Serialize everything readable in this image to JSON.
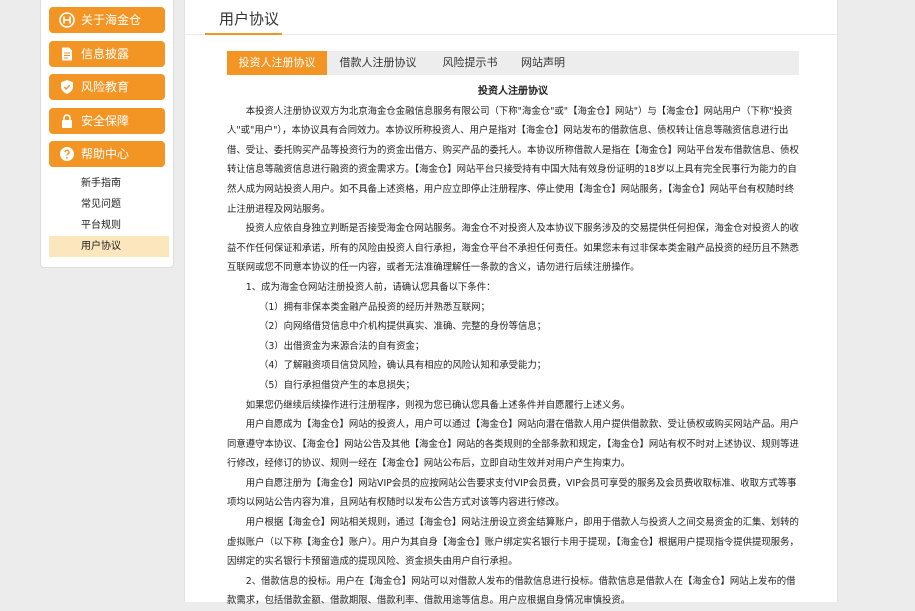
{
  "sidebar": {
    "items": [
      {
        "label": "关于海金仓",
        "icon": "logo-icon"
      },
      {
        "label": "信息披露",
        "icon": "document-icon"
      },
      {
        "label": "风险教育",
        "icon": "shield-icon"
      },
      {
        "label": "安全保障",
        "icon": "lock-icon"
      },
      {
        "label": "帮助中心",
        "icon": "question-icon"
      }
    ],
    "sub_items": [
      "新手指南",
      "常见问题",
      "平台规则",
      "用户协议"
    ]
  },
  "main": {
    "title": "用户协议",
    "tabs": [
      "投资人注册协议",
      "借款人注册协议",
      "风险提示书",
      "网站声明"
    ]
  },
  "doc": {
    "title": "投资人注册协议",
    "paragraphs": [
      "本投资人注册协议双方为北京海金仓金融信息服务有限公司（下称\"海金仓\"或\"【海金仓】网站\"）与【海金仓】网站用户（下称\"投资人\"或\"用户\"），本协议具有合同效力。本协议所称投资人、用户是指对【海金仓】网站发布的借款信息、债权转让信息等融资信息进行出借、受让、委托购买产品等投资行为的资金出借方、购买产品的委托人。本协议所称借款人是指在【海金仓】网站平台发布借款信息、债权转让信息等融资信息进行融资的资金需求方。【海金仓】网站平台只接受持有中国大陆有效身份证明的18岁以上具有完全民事行为能力的自然人成为网站投资人用户。如不具备上述资格，用户应立即停止注册程序、停止使用【海金仓】网站服务，【海金仓】网站平台有权随时终止注册进程及网站服务。",
      "投资人应依自身独立判断是否接受海金仓网站服务。海金仓不对投资人及本协议下服务涉及的交易提供任何担保，海金仓对投资人的收益不作任何保证和承诺，所有的风险由投资人自行承担，海金仓平台不承担任何责任。如果您未有过非保本类金融产品投资的经历且不熟悉互联网或您不同意本协议的任一内容，或者无法准确理解任一条款的含义，请勿进行后续注册操作。",
      "1、成为海金仓网站注册投资人前，请确认您具备以下条件：",
      "（1）拥有非保本类金融产品投资的经历并熟悉互联网；",
      "（2）向网络借贷信息中介机构提供真实、准确、完整的身份等信息；",
      "（3）出借资金为来源合法的自有资金；",
      "（4）了解融资项目信贷风险，确认具有相应的风险认知和承受能力；",
      "（5）自行承担借贷产生的本息损失；",
      "如果您仍继续后续操作进行注册程序，则视为您已确认您具备上述条件并自愿履行上述义务。",
      "用户自愿成为【海金仓】网站的投资人，用户可以通过【海金仓】网站向潜在借款人用户提供借款款、受让债权或购买网站产品。用户同意遵守本协议、【海金仓】网站公告及其他【海金仓】网站的各类规则的全部条款和规定，【海金仓】网站有权不时对上述协议、规则等进行修改，经修订的协议、规则一经在【海金仓】网站公布后，立即自动生效并对用户产生拘束力。",
      "用户自愿注册为【海金仓】网站VIP会员的应按网站公告要求支付VIP会员费，VIP会员可享受的服务及会员费收取标准、收取方式等事项均以网站公告内容为准，且网站有权随时以发布公告方式对该等内容进行修改。",
      "用户根据【海金仓】网站相关规则，通过【海金仓】网站注册设立资金结算账户，即用于借款人与投资人之间交易资金的汇集、划转的虚拟账户（以下称【海金仓】账户）。用户为其自身【海金仓】账户绑定实名银行卡用于提现，【海金仓】根据用户提现指令提供提现服务，因绑定的实名银行卡预留造成的提现风险、资金损失由用户自行承担。",
      "2、借款信息的投标。用户在【海金仓】网站可以对借款人发布的借款信息进行投标。借款信息是借款人在【海金仓】网站上发布的借款需求，包括借款金额、借款期限、借款利率、借款用途等信息。用户应根据自身情况审慎投资。"
    ]
  },
  "colors": {
    "accent": "#f29524",
    "active_sub_bg": "#fbe6bd",
    "page_bg": "#ececec",
    "tab_bg": "#ededed"
  }
}
